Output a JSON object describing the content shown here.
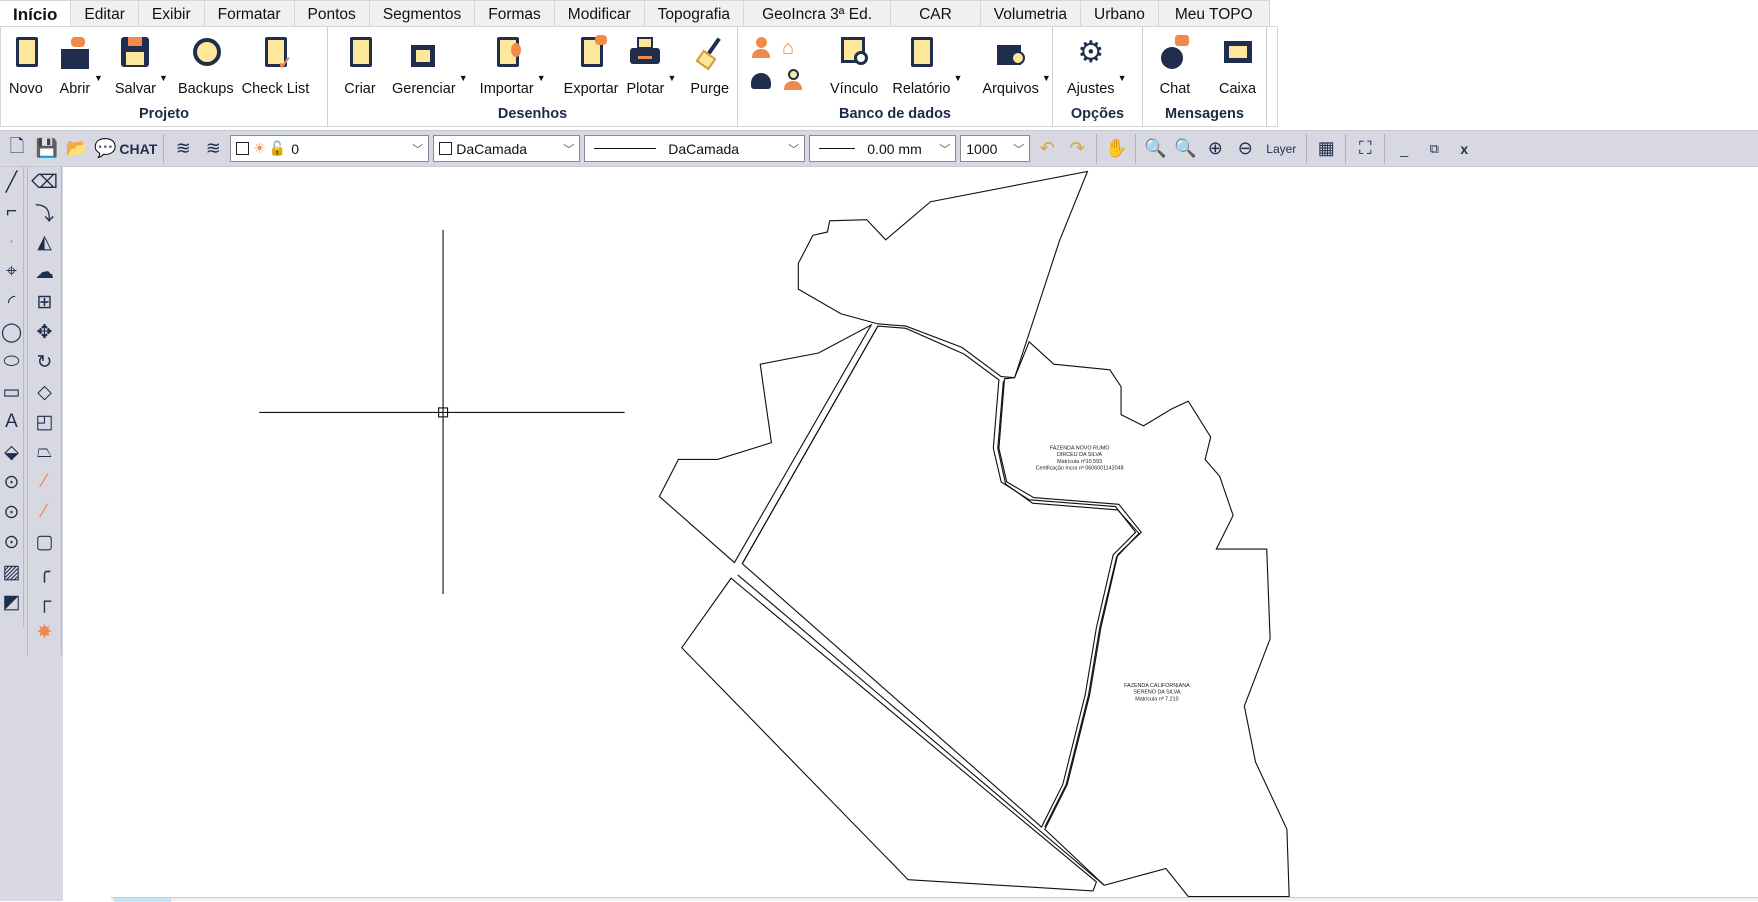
{
  "tabs": [
    "Início",
    "Editar",
    "Exibir",
    "Formatar",
    "Pontos",
    "Segmentos",
    "Formas",
    "Modificar",
    "Topografia",
    "GeoIncra 3ª Ed.",
    "CAR",
    "Volumetria",
    "Urbano",
    "Meu TOPO"
  ],
  "ribbon": {
    "projeto": {
      "label": "Projeto",
      "items": [
        "Novo",
        "Abrir",
        "Salvar",
        "Backups",
        "Check List"
      ]
    },
    "desenhos": {
      "label": "Desenhos",
      "items": [
        "Criar",
        "Gerenciar",
        "Importar",
        "Exportar",
        "Plotar",
        "Purge"
      ]
    },
    "banco": {
      "label": "Banco de dados",
      "items": [
        "Vínculo",
        "Relatório",
        "Arquivos"
      ]
    },
    "opcoes": {
      "label": "Opções",
      "items": [
        "Ajustes"
      ]
    },
    "mensagens": {
      "label": "Mensagens",
      "items": [
        "Chat",
        "Caixa"
      ]
    }
  },
  "toolbar": {
    "chat_label": "CHAT",
    "layer_value": "0",
    "color_value": "DaCamada",
    "linetype_value": "DaCamada",
    "lineweight_value": "0.00 mm",
    "scale_value": "1000",
    "layer_label": "Layer"
  },
  "drawing": {
    "labels": [
      [
        "FAZENDA NOVO RUMO",
        "DIRCEU DA SILVA",
        "Matrícula nº10.593",
        "Certificação Incra nº 0606001142048"
      ],
      [
        "FAZENDA CALIFORNIANA",
        "SERENO DA SILVA",
        "Matrícula nº 7.210"
      ]
    ]
  },
  "colors": {
    "accent": "#f08a4b",
    "icon_dark": "#1f2e4d",
    "icon_fill": "#fde79a",
    "toolbar_bg": "#d7d8e2"
  }
}
